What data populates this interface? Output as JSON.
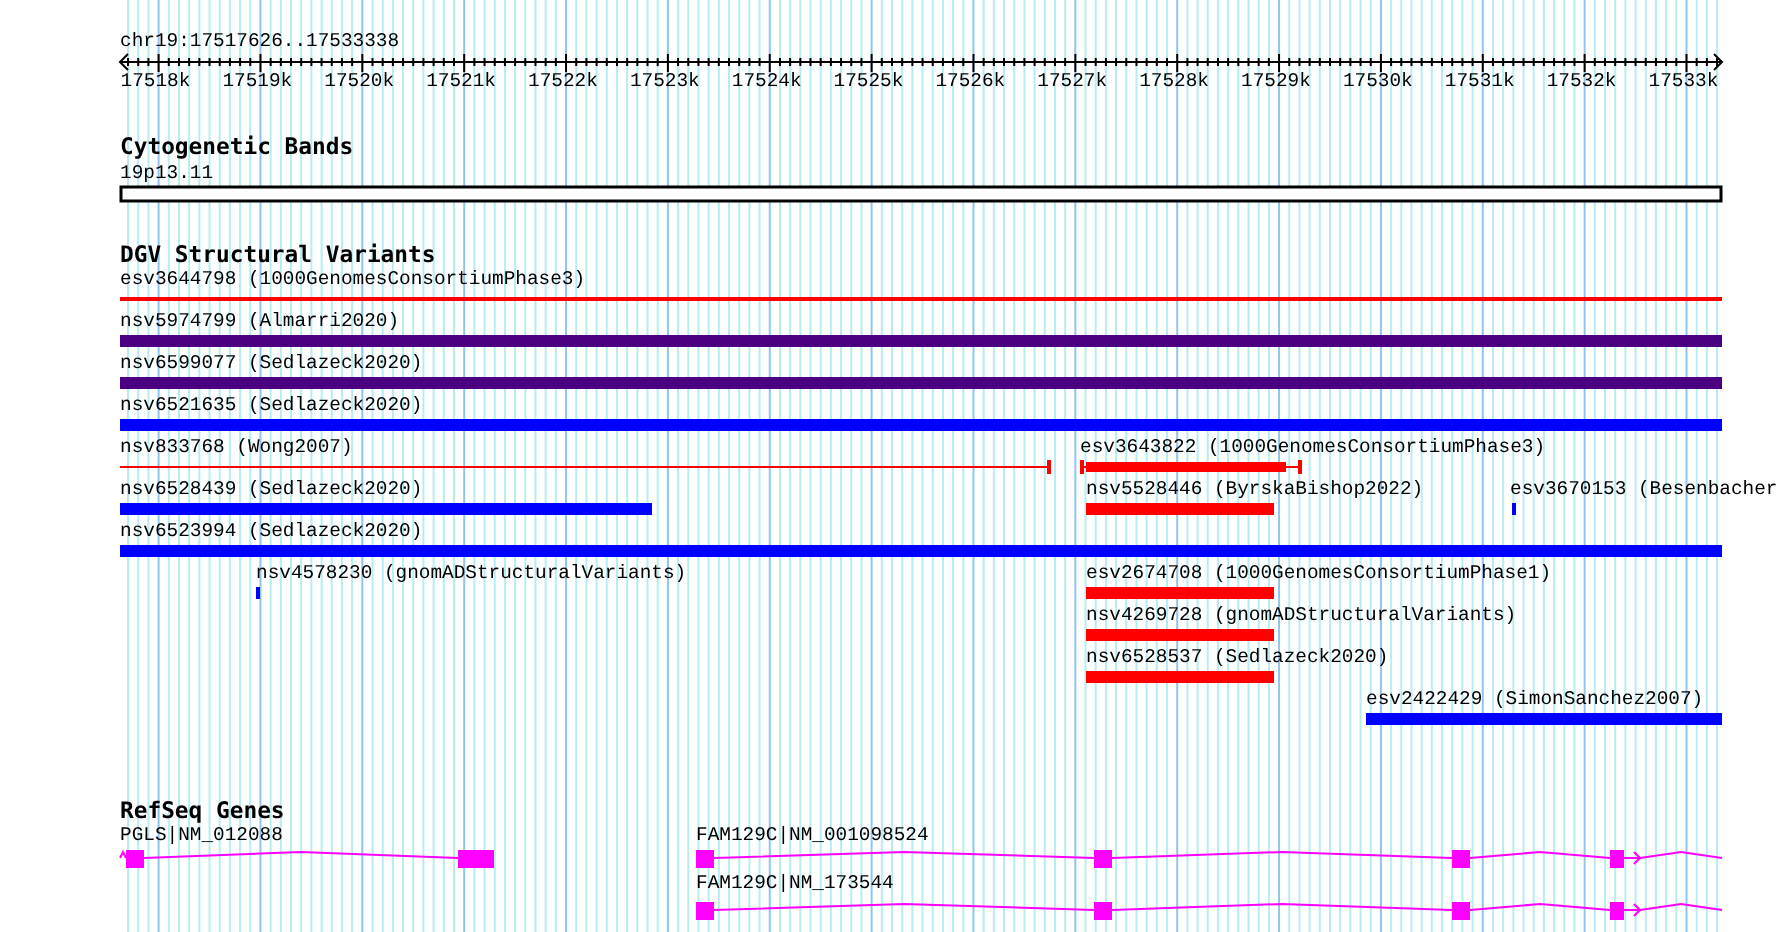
{
  "location": "chr19:17517626..17533338",
  "ruler": {
    "ticks": [
      "17518k",
      "17519k",
      "17520k",
      "17521k",
      "17522k",
      "17523k",
      "17524k",
      "17525k",
      "17526k",
      "17527k",
      "17528k",
      "17529k",
      "17530k",
      "17531k",
      "17532k",
      "17533k"
    ]
  },
  "tracks": [
    {
      "title": "Cytogenetic Bands",
      "kind": "bands",
      "features": [
        {
          "label": "19p13.11"
        }
      ]
    },
    {
      "title": "DGV Structural Variants",
      "kind": "variants",
      "features": [
        {
          "label": "esv3644798 (1000GenomesConsortiumPhase3)",
          "kind": "line",
          "color": "#ff0000"
        },
        {
          "label": "nsv5974799 (Almarri2020)",
          "kind": "bar",
          "color": "#4b0082"
        },
        {
          "label": "nsv6599077 (Sedlazeck2020)",
          "kind": "bar",
          "color": "#4b0082"
        },
        {
          "label": "nsv6521635 (Sedlazeck2020)",
          "kind": "bar",
          "color": "#0000ff"
        },
        {
          "label": "nsv833768 (Wong2007)",
          "kind": "line",
          "color": "#ff0000"
        },
        {
          "label": "esv3643822 (1000GenomesConsortiumPhase3)",
          "kind": "line-bar",
          "color": "#ff0000"
        },
        {
          "label": "nsv6528439 (Sedlazeck2020)",
          "kind": "bar",
          "color": "#0000ff"
        },
        {
          "label": "nsv5528446 (ByrskaBishop2022)",
          "kind": "bar",
          "color": "#ff0000"
        },
        {
          "label": "esv3670153 (Besenbacher",
          "kind": "bar",
          "color": "#0000ff"
        },
        {
          "label": "nsv6523994 (Sedlazeck2020)",
          "kind": "bar",
          "color": "#0000ff"
        },
        {
          "label": "nsv4578230 (gnomADStructuralVariants)",
          "kind": "bar",
          "color": "#0000ff"
        },
        {
          "label": "esv2674708 (1000GenomesConsortiumPhase1)",
          "kind": "bar",
          "color": "#ff0000"
        },
        {
          "label": "nsv4269728 (gnomADStructuralVariants)",
          "kind": "bar",
          "color": "#ff0000"
        },
        {
          "label": "nsv6528537 (Sedlazeck2020)",
          "kind": "bar",
          "color": "#ff0000"
        },
        {
          "label": "esv2422429 (SimonSanchez2007)",
          "kind": "bar",
          "color": "#0000ff"
        }
      ]
    },
    {
      "title": "RefSeq Genes",
      "kind": "genes",
      "features": [
        {
          "label": "PGLS|NM_012088",
          "color": "#ff00ff"
        },
        {
          "label": "FAM129C|NM_001098524",
          "color": "#ff00ff"
        },
        {
          "label": "FAM129C|NM_173544",
          "color": "#ff00ff"
        }
      ]
    }
  ]
}
